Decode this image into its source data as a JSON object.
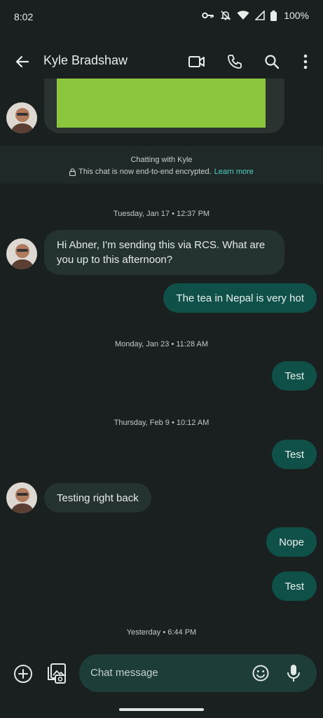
{
  "status_bar": {
    "time": "8:02",
    "battery": "100%"
  },
  "app_bar": {
    "title": "Kyle Bradshaw"
  },
  "banner": {
    "line1": "Chatting with Kyle",
    "line2": "This chat is now end-to-end encrypted.",
    "learn_more": "Learn more"
  },
  "timestamps": [
    "Tuesday, Jan 17 • 12:37 PM",
    "Monday, Jan 23 • 11:28 AM",
    "Thursday, Feb 9 • 10:12 AM",
    "Yesterday • 6:44 PM"
  ],
  "messages": [
    {
      "text": "Hi Abner, I'm sending this via RCS. What are you up to this afternoon?"
    },
    {
      "text": "The tea in Nepal is very hot"
    },
    {
      "text": "Test"
    },
    {
      "text": "Test"
    },
    {
      "text": "Testing right back"
    },
    {
      "text": "Nope"
    },
    {
      "text": "Test"
    }
  ],
  "composer": {
    "placeholder": "Chat message"
  },
  "colors": {
    "background": "#1a201f",
    "incoming_bubble": "#243230",
    "outgoing_bubble": "#0f5048",
    "accent": "#4fd1c0"
  },
  "icons": [
    "back-arrow-icon",
    "video-call-icon",
    "phone-icon",
    "search-icon",
    "more-vert-icon",
    "add-circle-icon",
    "gallery-icon",
    "emoji-icon",
    "mic-icon",
    "lock-icon",
    "key-icon",
    "bell-off-icon",
    "wifi-icon",
    "signal-icon",
    "battery-icon"
  ]
}
